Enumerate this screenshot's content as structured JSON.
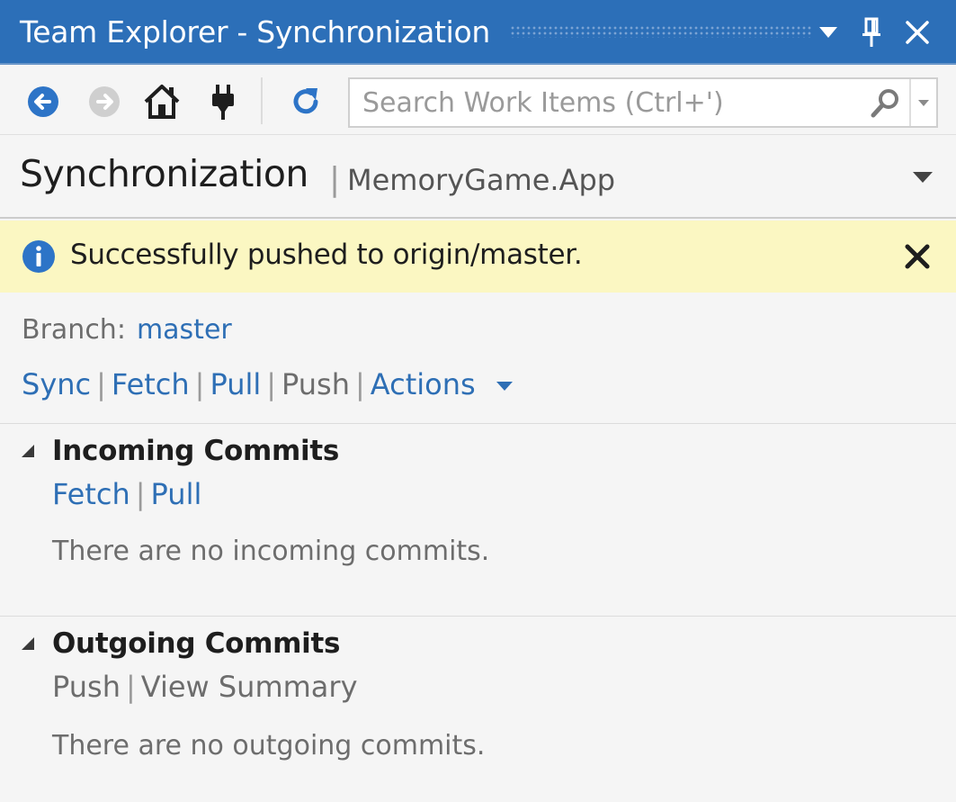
{
  "window": {
    "title": "Team Explorer - Synchronization"
  },
  "toolbar": {
    "search_placeholder": "Search Work Items (Ctrl+')"
  },
  "header": {
    "title": "Synchronization",
    "separator": "|",
    "subtitle": "MemoryGame.App"
  },
  "notification": {
    "message": "Successfully pushed to origin/master."
  },
  "branch": {
    "label": "Branch:",
    "value": "master"
  },
  "actions_bar": {
    "sync": "Sync",
    "fetch": "Fetch",
    "pull": "Pull",
    "push": "Push",
    "actions": "Actions"
  },
  "incoming": {
    "title": "Incoming Commits",
    "fetch": "Fetch",
    "pull": "Pull",
    "empty_message": "There are no incoming commits."
  },
  "outgoing": {
    "title": "Outgoing Commits",
    "push": "Push",
    "view_summary": "View Summary",
    "empty_message": "There are no outgoing commits."
  },
  "colors": {
    "titlebar": "#2c6fb8",
    "link": "#2e6fb5",
    "banner": "#fbf7c2",
    "info_icon": "#2d74c7"
  }
}
